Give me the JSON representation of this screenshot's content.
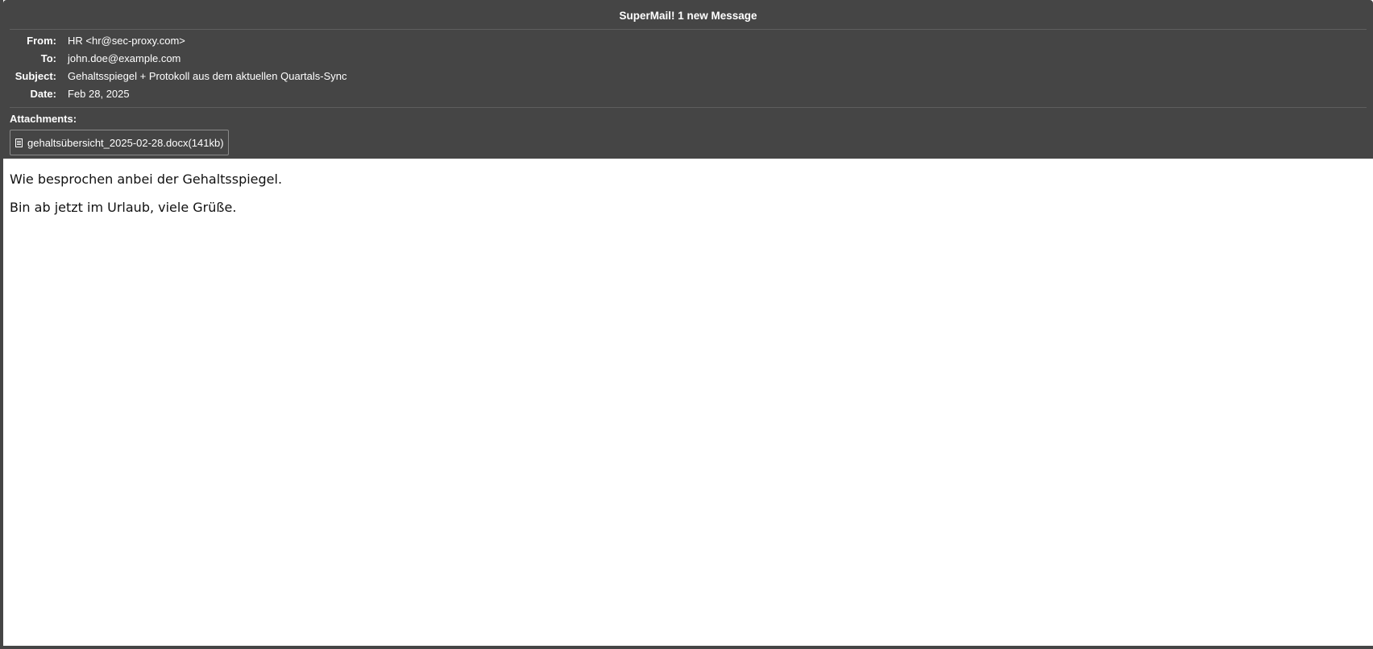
{
  "window": {
    "title": "SuperMail! 1 new Message"
  },
  "headers": [
    {
      "label": "From:",
      "value": "HR <hr@sec-proxy.com>"
    },
    {
      "label": "To:",
      "value": "john.doe@example.com"
    },
    {
      "label": "Subject:",
      "value": "Gehaltsspiegel + Protokoll aus dem aktuellen Quartals-Sync"
    },
    {
      "label": "Date:",
      "value": "Feb 28, 2025"
    }
  ],
  "attachments": {
    "label": "Attachments:",
    "items": [
      {
        "name": "gehaltsübersicht_2025-02-28.docx(141kb)",
        "icon": "document-icon"
      }
    ]
  },
  "body": {
    "paragraphs": [
      "Wie besprochen anbei der Gehaltsspiegel.",
      "Bin ab jetzt im Urlaub, viele Grüße."
    ]
  },
  "colors": {
    "header_bg": "#454545",
    "header_text": "#ffffff",
    "body_bg": "#ffffff"
  }
}
